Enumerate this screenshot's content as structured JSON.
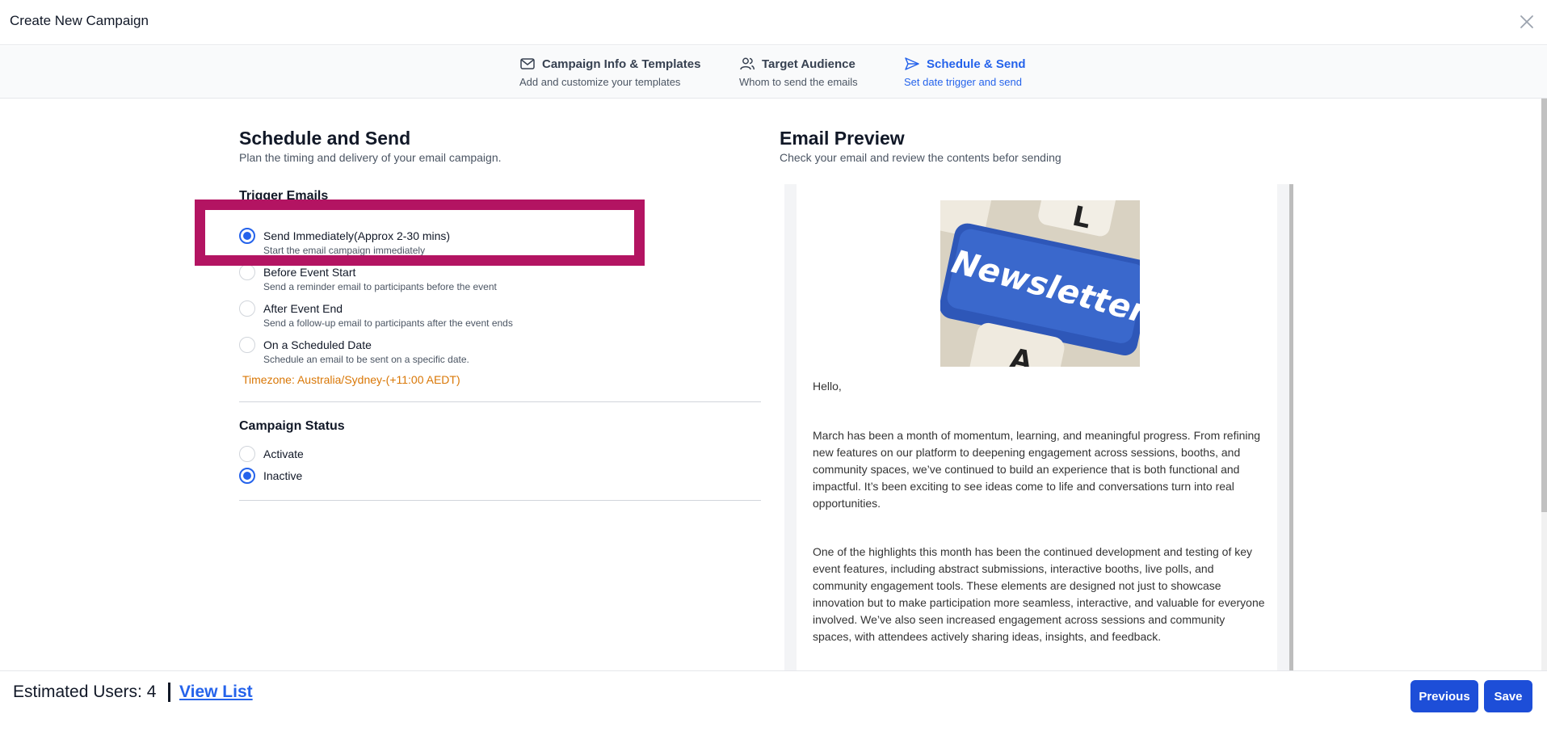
{
  "header": {
    "title": "Create New Campaign",
    "close_icon": "close-icon"
  },
  "stepper": {
    "steps": [
      {
        "title": "Campaign Info & Templates",
        "subtitle": "Add and customize your templates",
        "icon": "mail-icon",
        "state": "default"
      },
      {
        "title": "Target Audience",
        "subtitle": "Whom to send the emails",
        "icon": "users-icon",
        "state": "default"
      },
      {
        "title": "Schedule & Send",
        "subtitle": "Set date trigger and send",
        "icon": "send-icon",
        "state": "active"
      }
    ]
  },
  "schedule": {
    "title": "Schedule and Send",
    "subtitle": "Plan the timing and delivery of your email campaign.",
    "trigger_label": "Trigger Emails",
    "triggers": [
      {
        "label": "Send Immediately(Approx 2-30 mins)",
        "description": "Start the email campaign immediately",
        "checked": true
      },
      {
        "label": "Before Event Start",
        "description": "Send a reminder email to participants before the event",
        "checked": false
      },
      {
        "label": "After Event End",
        "description": "Send a follow-up email to participants after the event ends",
        "checked": false
      },
      {
        "label": "On a Scheduled Date",
        "description": "Schedule an email to be sent on a specific date.",
        "checked": false
      }
    ],
    "timezone": "Timezone: Australia/Sydney-(+11:00 AEDT)",
    "status_label": "Campaign Status",
    "statuses": [
      {
        "label": "Activate",
        "checked": false
      },
      {
        "label": "Inactive",
        "checked": true
      }
    ]
  },
  "preview": {
    "title": "Email Preview",
    "subtitle": "Check your email and review the contents befor sending",
    "image_text": "Newsletter",
    "image_key_letters": [
      "L",
      "A"
    ],
    "greeting": "Hello,",
    "paragraphs": [
      "March has been a month of momentum, learning, and meaningful progress. From refining new features on our platform to deepening engagement across sessions, booths, and community spaces, we’ve continued to build an experience that is both functional and impactful. It’s been exciting to see ideas come to life and conversations turn into real opportunities.",
      "One of the highlights this month has been the continued development and testing of key event features, including abstract submissions, interactive booths, live polls, and community engagement tools. These elements are designed not just to showcase innovation but to make participation more seamless, interactive, and valuable for everyone involved. We’ve also seen increased engagement across sessions and community spaces, with attendees actively sharing ideas, insights, and feedback."
    ]
  },
  "footer": {
    "estimated_users": "Estimated Users: 4",
    "view_list": "View List",
    "previous": "Previous",
    "save": "Save"
  },
  "colors": {
    "accent": "#2563eb",
    "button": "#1d4ed8",
    "timezone": "#d97706",
    "highlight": "#b31462"
  }
}
